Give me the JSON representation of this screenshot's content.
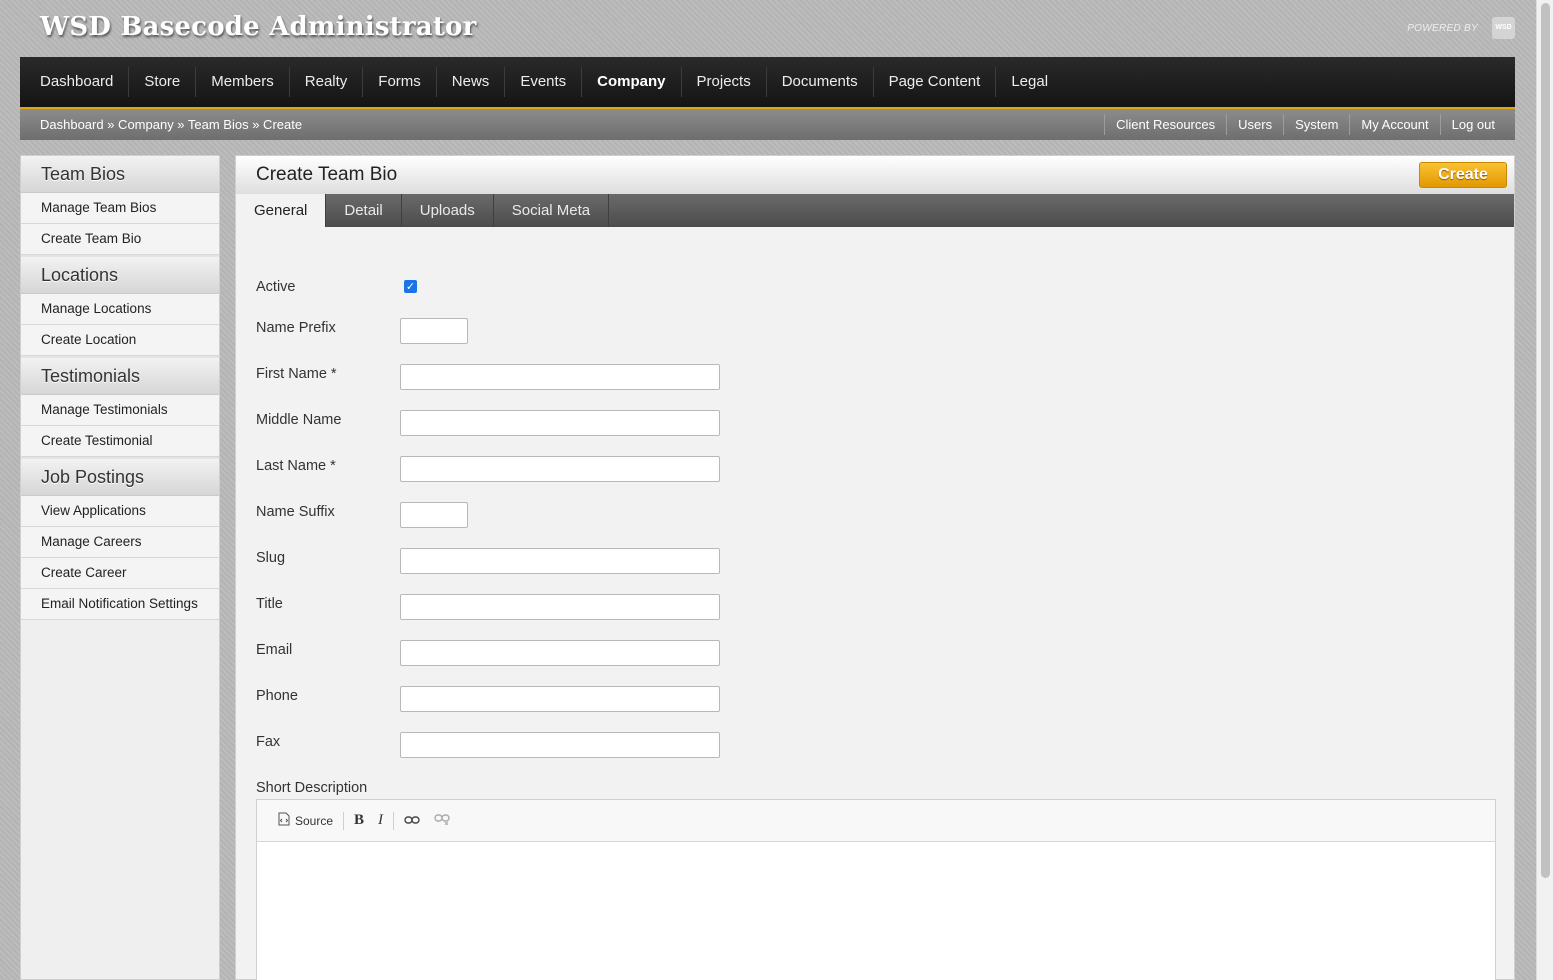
{
  "app": {
    "title": "WSD Basecode Administrator",
    "powered_by": "POWERED BY",
    "logo_text": "WSD"
  },
  "main_nav": {
    "items": [
      "Dashboard",
      "Store",
      "Members",
      "Realty",
      "Forms",
      "News",
      "Events",
      "Company",
      "Projects",
      "Documents",
      "Page Content",
      "Legal"
    ],
    "active": "Company"
  },
  "breadcrumb": "Dashboard » Company » Team Bios » Create",
  "util_links": [
    "Client Resources",
    "Users",
    "System",
    "My Account",
    "Log out"
  ],
  "sidebar": {
    "sections": [
      {
        "title": "Team Bios",
        "items": [
          "Manage Team Bios",
          "Create Team Bio"
        ]
      },
      {
        "title": "Locations",
        "items": [
          "Manage Locations",
          "Create Location"
        ]
      },
      {
        "title": "Testimonials",
        "items": [
          "Manage Testimonials",
          "Create Testimonial"
        ]
      },
      {
        "title": "Job Postings",
        "items": [
          "View Applications",
          "Manage Careers",
          "Create Career",
          "Email Notification Settings"
        ]
      }
    ]
  },
  "content": {
    "page_title": "Create Team Bio",
    "create_label": "Create",
    "tabs": [
      "General",
      "Detail",
      "Uploads",
      "Social Meta"
    ],
    "active_tab": "General"
  },
  "form": {
    "active_label": "Active",
    "active_checked": true,
    "fields": [
      {
        "label": "Name Prefix",
        "value": ""
      },
      {
        "label": "First Name *",
        "value": ""
      },
      {
        "label": "Middle Name",
        "value": ""
      },
      {
        "label": "Last Name *",
        "value": ""
      },
      {
        "label": "Name Suffix",
        "value": ""
      },
      {
        "label": "Slug",
        "value": ""
      },
      {
        "label": "Title",
        "value": ""
      },
      {
        "label": "Email",
        "value": ""
      },
      {
        "label": "Phone",
        "value": ""
      },
      {
        "label": "Fax",
        "value": ""
      }
    ],
    "short_description_label": "Short Description",
    "editor": {
      "source_label": "Source",
      "icons": [
        "source-icon",
        "bold-icon",
        "italic-icon",
        "link-icon",
        "unlink-icon"
      ]
    }
  },
  "colors": {
    "accent": "#e0a80f",
    "create_button": "#f5ad14",
    "checkbox": "#1a73e8"
  }
}
